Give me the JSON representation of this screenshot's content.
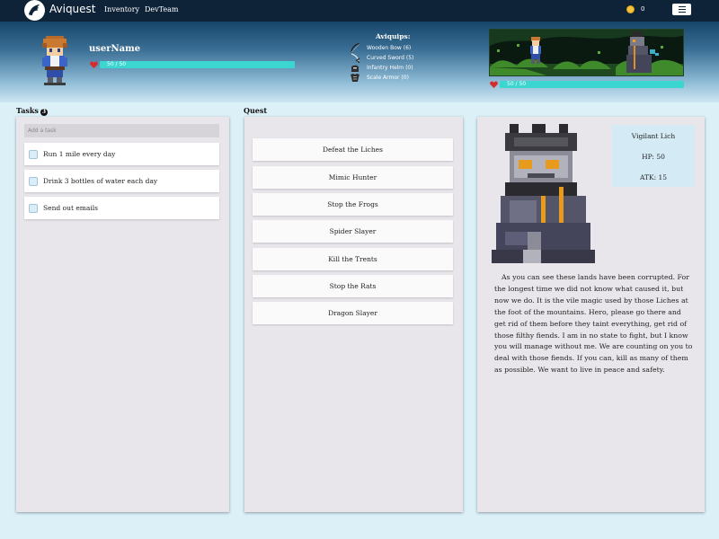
{
  "app": {
    "title": "Aviquest"
  },
  "nav": {
    "links": [
      "Inventory",
      "DevTeam"
    ],
    "coins": "0"
  },
  "player": {
    "name": "userName",
    "hp_text": "50 / 50",
    "hp_fraction": 1.0
  },
  "aviquips": {
    "title": "Aviquips:",
    "items": [
      {
        "label": "Wooden Bow (6)",
        "icon": "bow-icon"
      },
      {
        "label": "Curved Sword (5)",
        "icon": "sword-icon"
      },
      {
        "label": "Infantry Helm (0)",
        "icon": "helm-icon"
      },
      {
        "label": "Scale Armor (0)",
        "icon": "armor-icon"
      }
    ]
  },
  "battle": {
    "enemy_hp_text": "50 / 50",
    "enemy_hp_fraction": 1.0
  },
  "tasks": {
    "label": "Tasks",
    "count": "3",
    "placeholder": "Add a task",
    "items": [
      "Run 1 mile every day",
      "Drink 3 bottles of water each day",
      "Send out emails"
    ]
  },
  "quest": {
    "label": "Quest",
    "items": [
      "Defeat the Liches",
      "Mimic Hunter",
      "Stop the Frogs",
      "Spider Slayer",
      "Kill the Trents",
      "Stop the Rats",
      "Dragon Slayer"
    ]
  },
  "enemy": {
    "name": "Vigilant Lich",
    "hp": "HP: 50",
    "atk": "ATK: 15",
    "story": "As you can see these lands have been corrupted. For the longest time we did not know what caused it, but now we do. It is the vile magic used by those Liches at the foot of the mountains. Hero, please go there and get rid of them before they taint everything, get rid of those filthy fiends. I am in no state to fight, but I know you will manage without me. We are counting on you to deal with those fiends. If you can, kill as many of them as possible. We want to live in peace and safety."
  },
  "colors": {
    "nav": "#0e2238",
    "hp_bar": "#3ad6cf",
    "heart": "#d62b2b",
    "panel": "#e8e6ea",
    "enemy_card": "#d4ebf6"
  }
}
